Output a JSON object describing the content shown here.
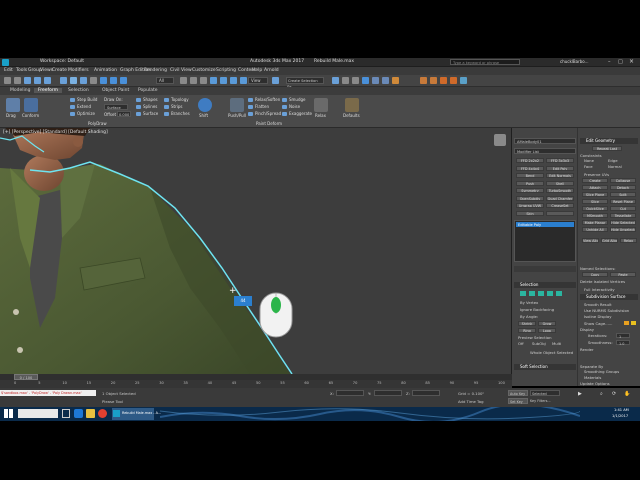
{
  "title_bar": {
    "workspace": "Workspace: Default",
    "app_title": "Autodesk 3ds Max 2017",
    "file_name": "Rebuild Male.max",
    "search_placeholder": "Type a keyword or phrase",
    "user": "chucklBarbo..."
  },
  "menus": [
    "Edit",
    "Tools",
    "Group",
    "Views",
    "Create",
    "Modifiers",
    "Animation",
    "Graph Editors",
    "Rendering",
    "Civil View",
    "Customize",
    "Scripting",
    "Content",
    "Help",
    "Arnold"
  ],
  "toolbar": {
    "selection_filter": "All",
    "view_dropdown": "View",
    "named_selection": "Create Selection Se"
  },
  "ribbon_tabs": [
    "Modeling",
    "Freeform",
    "Selection",
    "Object Paint",
    "Populate"
  ],
  "ribbon": {
    "polydraw_buttons": [
      "Step Build",
      "Extend",
      "Optimize"
    ],
    "draw_on": "Draw On:",
    "surface_dropdown": "Surface",
    "offset_label": "Offset",
    "offset_value": "0.000",
    "panel_polydraw": "PolyDraw",
    "panel_paint_deform": "Paint Deform",
    "shape_buttons": [
      "Shapes",
      "Splines",
      "Surface"
    ],
    "topology_buttons": [
      "Topology",
      "Strips",
      "Branches"
    ],
    "big_buttons": [
      "Drag",
      "Conform",
      "Shift",
      "Push/Pull",
      "Relax",
      "Defaults"
    ],
    "deform_buttons": [
      "Relax/Soften",
      "Flatten",
      "Pinch/Spread",
      "Smudge",
      "Noise",
      "Exaggerate"
    ]
  },
  "viewport": {
    "label": "[+] [Perspective] [Standard] [Default Shading]",
    "num_badge": "44"
  },
  "command_panel": {
    "object_name": "AMaleBody01",
    "modifier_list": "Modifier List",
    "modifier_buttons": [
      "FFD 2x2x2",
      "FFD 3x3x3",
      "FFD 4x4x4",
      "Edit Poly",
      "Bend",
      "Edit Normals",
      "Push",
      "Shell",
      "Symmetry",
      "TurboSmooth",
      "OpenSubdiv",
      "Quad Chamfer",
      "Unwrap UVW",
      "CreaseSet",
      "Skin",
      ""
    ],
    "stack_item": "Editable Poly",
    "rollout_selection": "Selection",
    "sel_options": [
      "By Vertex",
      "Ignore Backfacing",
      "By Angle:",
      "Shrink",
      "Grow",
      "Ring",
      "Loop"
    ],
    "preview_selection": "Preview Selection",
    "preview_options": [
      "Off",
      "SubObj",
      "Multi"
    ],
    "whole_object": "Whole Object Selected",
    "rollout_soft": "Soft Selection",
    "rollout_edit_geom": "Edit Geometry",
    "repeat_last": "Repeat Last",
    "constraints": "Constraints",
    "constraint_opts": [
      "None",
      "Edge",
      "Face",
      "Normal"
    ],
    "preserve_uvs": "Preserve UVs",
    "geom_buttons": [
      "Create",
      "Collapse",
      "Attach",
      "Detach",
      "Slice Plane",
      "Split",
      "Slice",
      "Reset Plane",
      "QuickSlice",
      "Cut",
      "MSmooth",
      "Tessellate",
      "Make Planar",
      "Hide Selected",
      "Unhide All",
      "Hide Unselected",
      "Named Selections:",
      "Copy",
      "Paste",
      "Delete Isolated Vertices",
      "Full Interactivity"
    ],
    "view_align": [
      "View Align",
      "Grid Align",
      "Relax"
    ],
    "rollout_subdiv": "Subdivision Surface",
    "subdiv_opts": [
      "Smooth Result",
      "Use NURMS Subdivision",
      "Isoline Display",
      "Show Cage......"
    ],
    "display_label": "Display",
    "iterations_label": "Iterations:",
    "iterations_value": "1",
    "smoothness_label": "Smoothness:",
    "smoothness_value": "1.0",
    "render_label": "Render",
    "separate_by": "Separate By",
    "smoothing_groups": "Smoothing Groups",
    "materials": "Materials",
    "update_options": "Update Options"
  },
  "timeline": {
    "frame": "0 / 100",
    "ticks": [
      "0",
      "5",
      "10",
      "15",
      "20",
      "25",
      "30",
      "35",
      "40",
      "45",
      "50",
      "55",
      "60",
      "65",
      "70",
      "75",
      "80",
      "85",
      "90",
      "95",
      "100"
    ]
  },
  "status": {
    "maxscript_text": "$'sandbox.max' - 'PolyDraw' - 'Poly Drawn.max'",
    "selected": "1 Object Selected",
    "prompt": "Please Tool",
    "x_label": "X:",
    "y_label": "Y:",
    "z_label": "Z:",
    "grid": "Grid = 0.100\"",
    "add_time_tag": "Add Time Tag",
    "auto_key": "Auto Key",
    "set_key": "Set Key",
    "selected_dd": "Selected",
    "key_filters": "Key Filters..."
  },
  "taskbar": {
    "clock_time": "1:41 AM",
    "clock_date": "1/1/2017",
    "active_task": "Rebuild Male.max - A..."
  },
  "colors": {
    "viewport_bg": "#3d3d3d",
    "panel_bg": "#444444",
    "accent_blue": "#2b7fcf",
    "selection_cyan": "#6ee4f0",
    "mouse_green": "#2bb54a",
    "jacket_green": "#4b5a34"
  }
}
